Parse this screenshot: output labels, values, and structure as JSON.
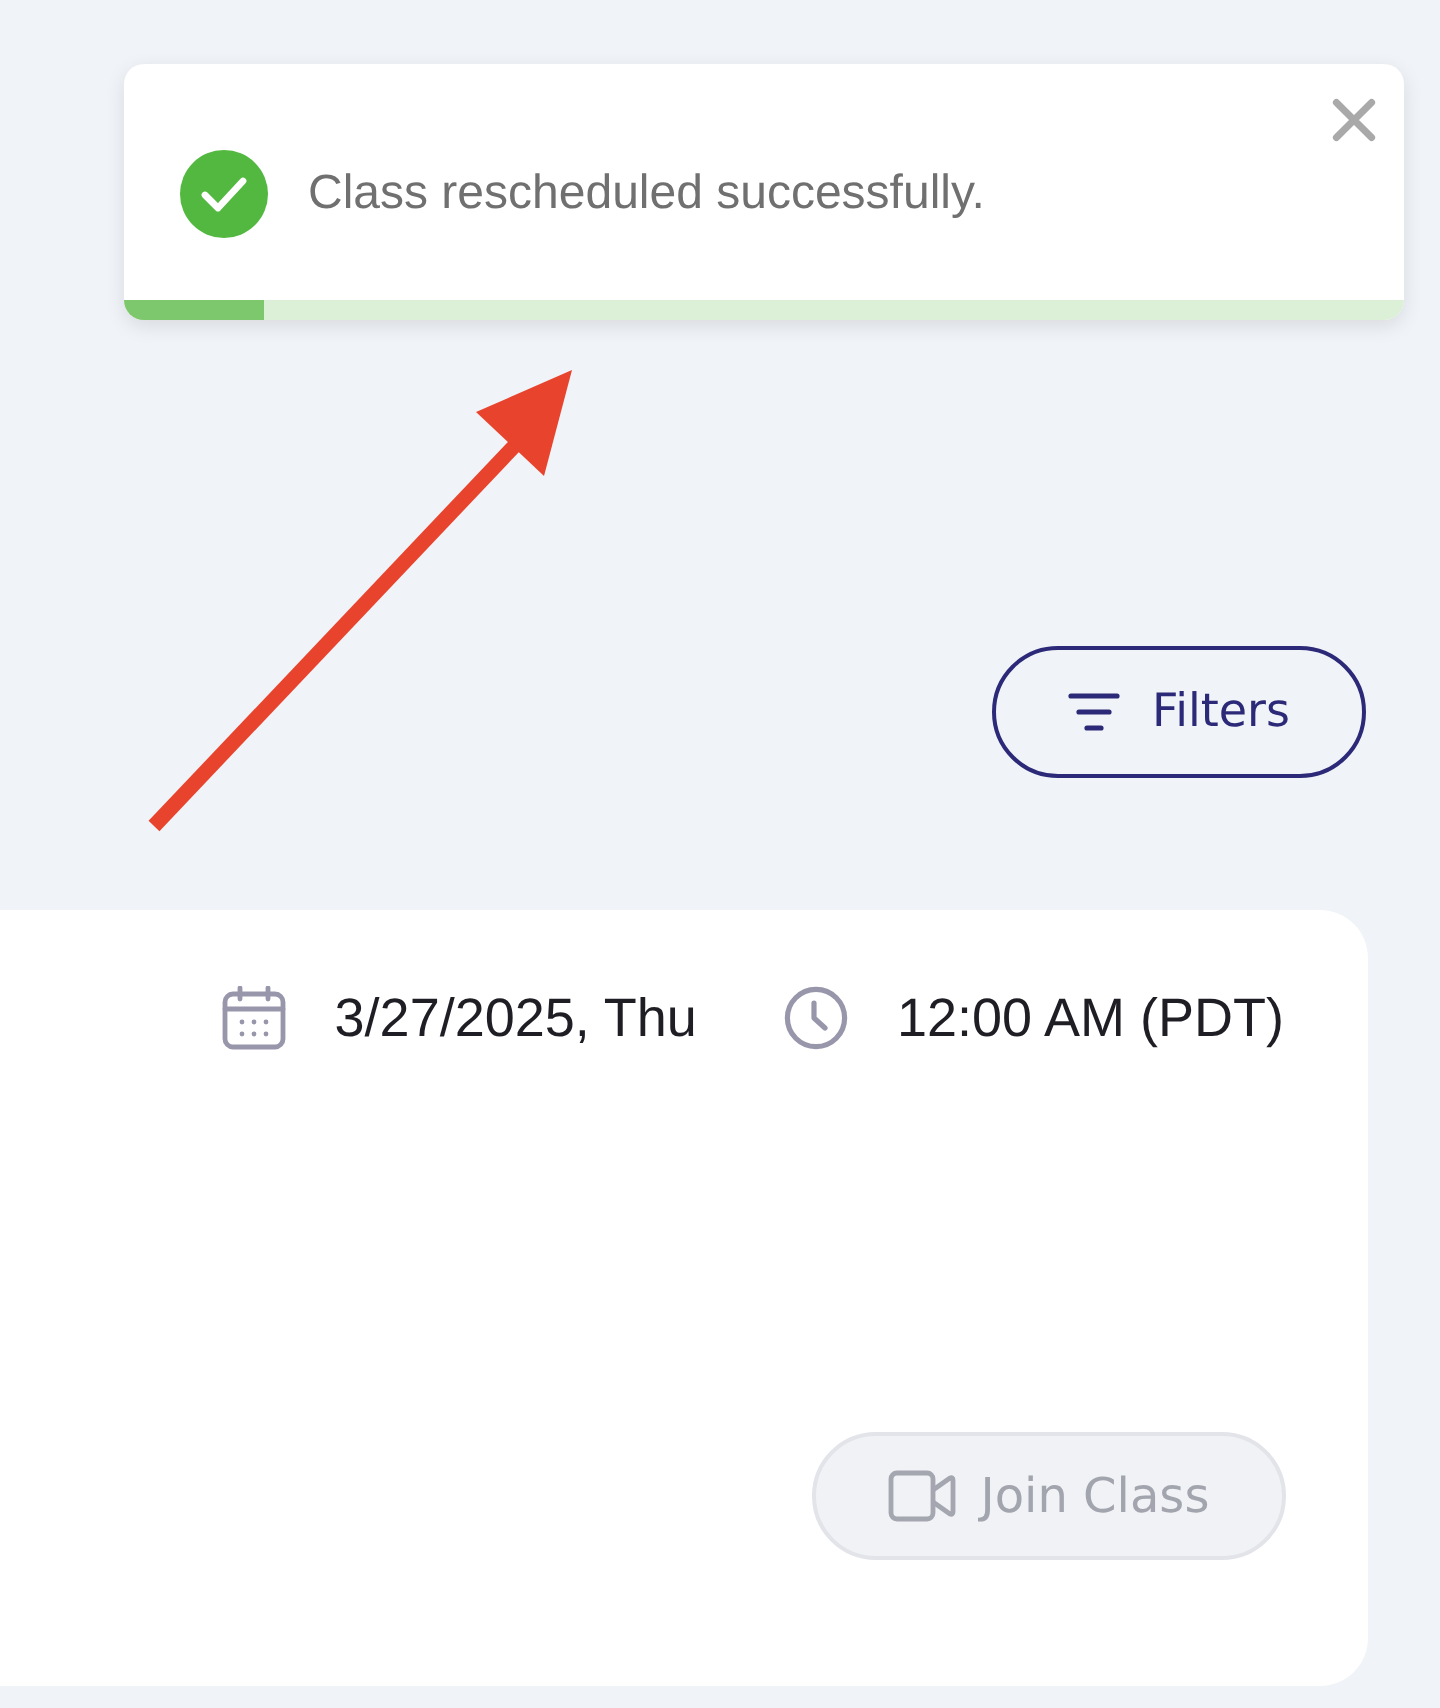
{
  "toast": {
    "kind": "success",
    "message": "Class rescheduled successfully.",
    "progress": {
      "level": 0.11
    }
  },
  "filters_button": {
    "label": "Filters"
  },
  "class_card": {
    "date": "3/27/2025, Thu",
    "time": "12:00 AM (PDT)",
    "join_button": {
      "label": "Join Class",
      "disabled": true
    }
  }
}
